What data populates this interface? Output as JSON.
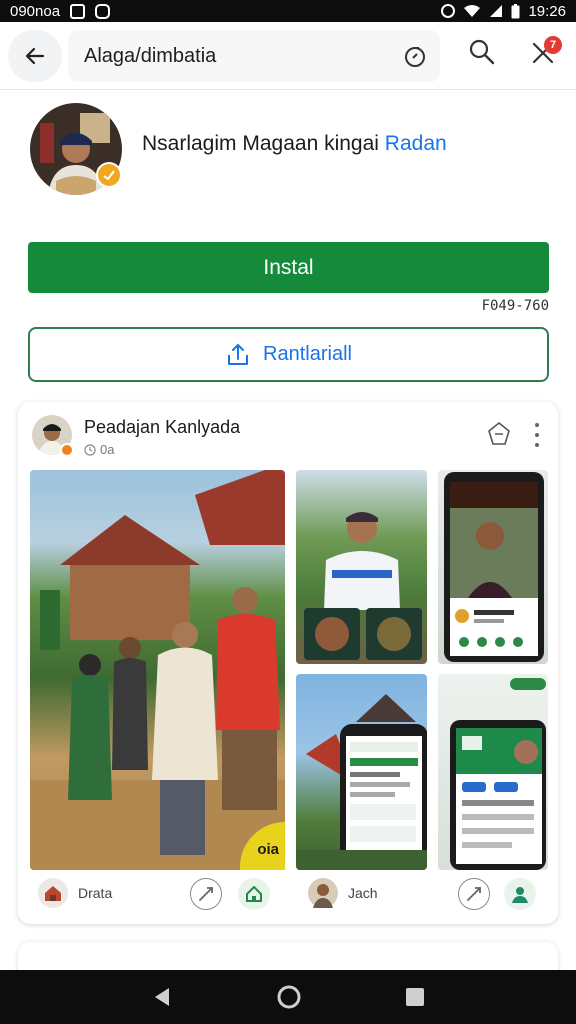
{
  "status_bar": {
    "left_text": "090noa",
    "time": "19:26"
  },
  "top_bar": {
    "search_text": "Alaga/dimbatia",
    "notification_count": "7"
  },
  "profile": {
    "name_main": "Nsarlagim Magaan kingai ",
    "name_accent": "Radan"
  },
  "install": {
    "label": "Instal",
    "size": "F049-760"
  },
  "secondary": {
    "label": "Rantlariall"
  },
  "post": {
    "title": "Peadajan Kanlyada",
    "subtitle": "0a",
    "tag": "oia",
    "footer_left_label": "Drata",
    "footer_right_label": "Jach"
  },
  "colors": {
    "install_green": "#168a3b",
    "accent_blue": "#1a73e8",
    "badge_red": "#e53935",
    "tag_yellow": "#e7d21c"
  }
}
